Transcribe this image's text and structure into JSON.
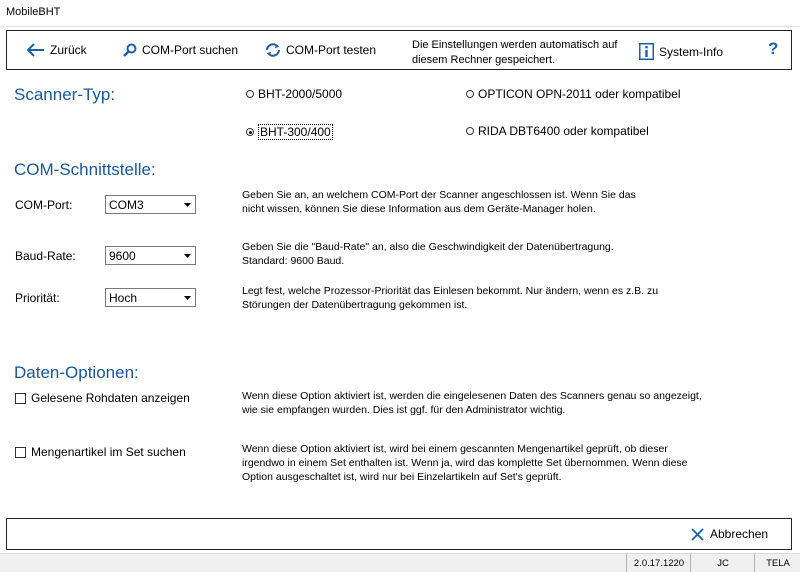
{
  "window": {
    "title": "MobileBHT"
  },
  "toolbar": {
    "back_label": "Zurück",
    "search_port_label": "COM-Port suchen",
    "test_port_label": "COM-Port testen",
    "note_line1": "Die Einstellungen werden automatisch auf",
    "note_line2": "diesem Rechner gespeichert.",
    "sysinfo_label": "System-Info",
    "help_label": "?"
  },
  "scanner": {
    "heading": "Scanner-Typ:",
    "options": [
      {
        "label": "BHT-2000/5000",
        "selected": false
      },
      {
        "label": "OPTICON OPN-2011 oder kompatibel",
        "selected": false
      },
      {
        "label": "BHT-300/400",
        "selected": true
      },
      {
        "label": "RIDA DBT6400 oder kompatibel",
        "selected": false
      }
    ]
  },
  "com": {
    "heading": "COM-Schnittstelle:",
    "port_label": "COM-Port:",
    "port_value": "COM3",
    "port_desc1": "Geben Sie an, an welchem COM-Port der Scanner angeschlossen ist. Wenn Sie das",
    "port_desc2": "nicht wissen, können Sie diese Information aus dem Geräte-Manager holen.",
    "baud_label": "Baud-Rate:",
    "baud_value": "9600",
    "baud_desc1": "Geben Sie die \"Baud-Rate\" an, also die Geschwindigkeit der Datenübertragung.",
    "baud_desc2": "Standard: 9600 Baud.",
    "prio_label": "Priorität:",
    "prio_value": "Hoch",
    "prio_desc1": "Legt fest, welche Prozessor-Priorität das Einlesen bekommt. Nur ändern, wenn es z.B. zu",
    "prio_desc2": "Störungen der Datenübertragung gekommen ist."
  },
  "daten": {
    "heading": "Daten-Optionen:",
    "raw_label": "Gelesene Rohdaten anzeigen",
    "raw_checked": false,
    "raw_desc1": "Wenn diese Option aktiviert ist, werden die eingelesenen Daten des Scanners genau so angezeigt,",
    "raw_desc2": "wie sie empfangen wurden.  Dies ist ggf. für den Administrator wichtig.",
    "set_label": "Mengenartikel im Set suchen",
    "set_checked": false,
    "set_desc1": "Wenn diese Option aktiviert ist, wird bei einem gescannten Mengenartikel geprüft, ob dieser",
    "set_desc2": "irgendwo in einem Set enthalten ist. Wenn ja, wird das komplette Set übernommen. Wenn diese",
    "set_desc3": "Option ausgeschaltet ist, wird nur bei Einzelartikeln auf Set's geprüft."
  },
  "footer": {
    "cancel_label": "Abbrechen"
  },
  "status": {
    "version": "2.0.17.1220",
    "user": "JC",
    "station": "TELA"
  },
  "colors": {
    "accent": "#1b5796",
    "heading": "#1b5796"
  }
}
